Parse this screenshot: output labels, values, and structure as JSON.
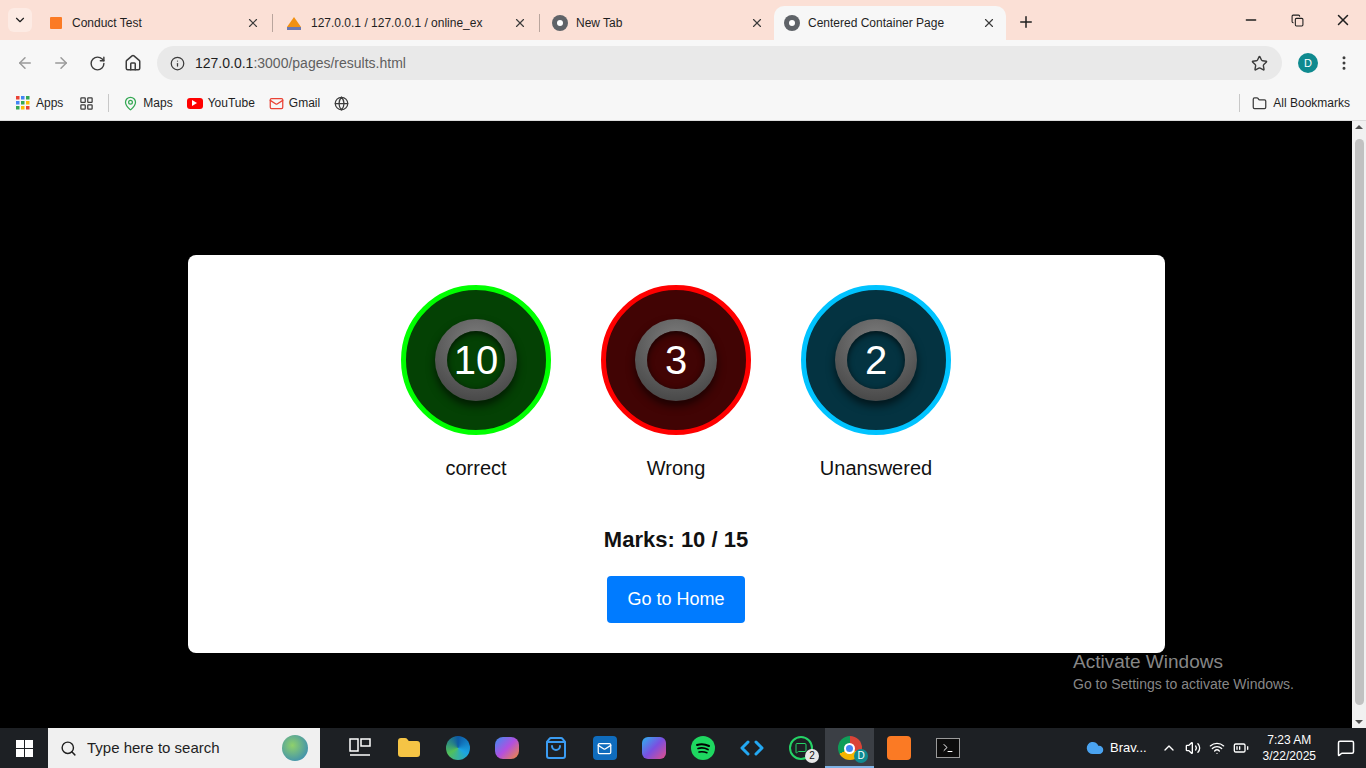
{
  "browser": {
    "tabs": [
      {
        "title": "Conduct Test",
        "kind": "xampp",
        "selected": false
      },
      {
        "title": "127.0.0.1 / 127.0.0.1 / online_ex",
        "kind": "pma",
        "selected": false
      },
      {
        "title": "New Tab",
        "kind": "newtab",
        "selected": false
      },
      {
        "title": "Centered Container Page",
        "kind": "page",
        "selected": true
      }
    ],
    "address": {
      "host": "127.0.0.1",
      "path": ":3000/pages/results.html"
    },
    "profile": "D",
    "bookmarks": [
      "Apps",
      "Maps",
      "YouTube",
      "Gmail"
    ],
    "all_bookmarks": "All Bookmarks"
  },
  "page": {
    "results": [
      {
        "count": "10",
        "label": "correct",
        "color": "#00ff00"
      },
      {
        "count": "3",
        "label": "Wrong",
        "color": "#ff0000"
      },
      {
        "count": "2",
        "label": "Unanswered",
        "color": "#00c3ff"
      }
    ],
    "marks": "Marks: 10 / 15",
    "button": "Go to Home"
  },
  "watermark": {
    "title": "Activate Windows",
    "subtitle": "Go to Settings to activate Windows."
  },
  "taskbar": {
    "search_placeholder": "Type here to search",
    "apps": [
      {
        "kind": "taskview",
        "badge": "",
        "selected": false
      },
      {
        "kind": "explorer",
        "badge": "",
        "selected": false
      },
      {
        "kind": "edge",
        "badge": "",
        "selected": false
      },
      {
        "kind": "copilot",
        "badge": "",
        "selected": false
      },
      {
        "kind": "store",
        "badge": "",
        "selected": false
      },
      {
        "kind": "outlook",
        "badge": "",
        "selected": false
      },
      {
        "kind": "m365",
        "badge": "",
        "selected": false
      },
      {
        "kind": "spotify",
        "badge": "",
        "selected": false
      },
      {
        "kind": "vscode",
        "badge": "",
        "selected": false
      },
      {
        "kind": "whatsapp",
        "badge": "2",
        "selected": false
      },
      {
        "kind": "chrome",
        "badge": "D",
        "selected": true
      },
      {
        "kind": "xampp",
        "badge": "",
        "selected": false
      },
      {
        "kind": "terminal",
        "badge": "",
        "selected": false
      }
    ],
    "widget": "Brav...",
    "time": "7:23 AM",
    "date": "3/22/2025"
  }
}
